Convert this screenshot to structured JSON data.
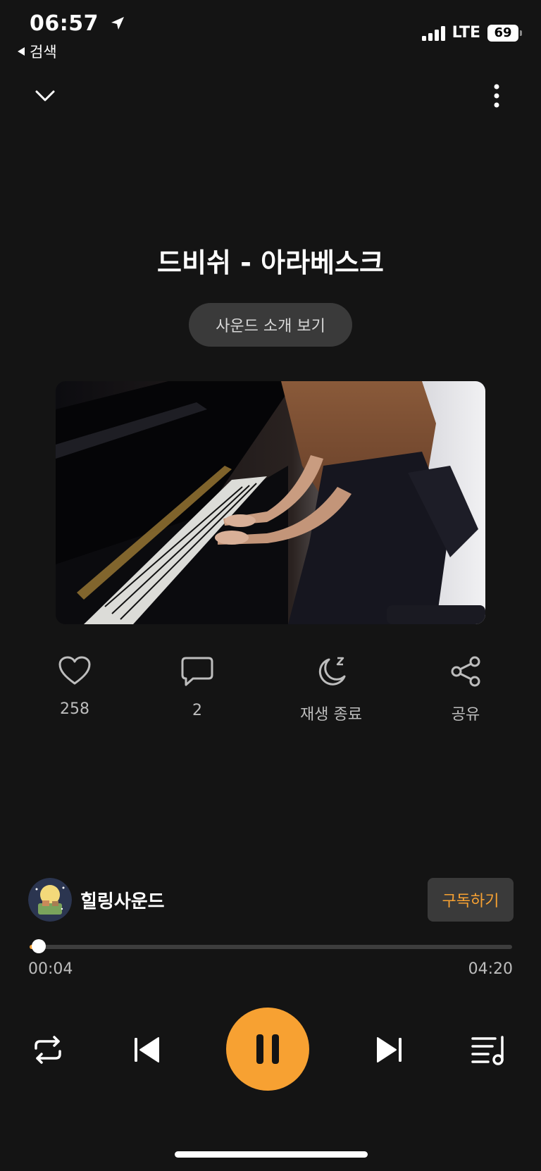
{
  "status_bar": {
    "time": "06:57",
    "back_label": "검색",
    "network": "LTE",
    "battery": "69"
  },
  "player": {
    "title": "드비쉬 - 아라베스크",
    "intro_button": "사운드 소개 보기",
    "artwork_icon": "girl-playing-piano-image"
  },
  "actions": {
    "like_count": "258",
    "comment_count": "2",
    "sleep_timer_label": "재생 종료",
    "share_label": "공유"
  },
  "channel": {
    "name": "힐링사운드",
    "subscribe_label": "구독하기"
  },
  "playback": {
    "current_time": "00:04",
    "total_time": "04:20",
    "progress": 0.015,
    "accent_color": "#f7a132"
  }
}
